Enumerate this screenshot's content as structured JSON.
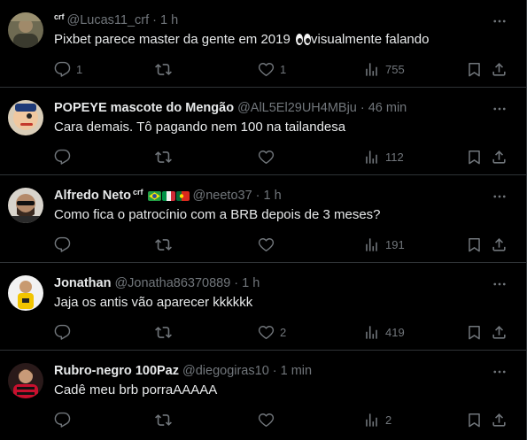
{
  "tweets": [
    {
      "name": "crf",
      "name_style": "small",
      "handle": "@Lucas11_crf",
      "time": "1 h",
      "text": "Pixbet parece master da gente em 2019",
      "text_after_emoji": "visualmente falando",
      "emoji": "eyes-emoji",
      "avatar_color": "#8a7a55",
      "replies": "1",
      "retweets": "",
      "likes": "1",
      "views": "755"
    },
    {
      "name": "POPEYE mascote do Mengão",
      "handle": "@AlL5El29UH4MBju",
      "time": "46 min",
      "text": "Cara demais. Tô pagando nem 100 na tailandesa",
      "avatar_color": "#c43a2c",
      "replies": "",
      "retweets": "",
      "likes": "",
      "views": "112"
    },
    {
      "name": "Alfredo Neto",
      "name_suffix": "crf",
      "flags": [
        "brazil-flag",
        "italy-flag",
        "portugal-flag"
      ],
      "handle": "@neeto37",
      "time": "1 h",
      "text": "Como fica o patrocínio com a BRB depois de 3 meses?",
      "avatar_color": "#6b5a4a",
      "replies": "",
      "retweets": "",
      "likes": "",
      "views": "191"
    },
    {
      "name": "Jonathan",
      "handle": "@Jonatha86370889",
      "time": "1 h",
      "text": "Jaja os antis vão aparecer kkkkkk",
      "avatar_color": "#e9e9e9",
      "replies": "",
      "retweets": "",
      "likes": "2",
      "views": "419"
    },
    {
      "name": "Rubro-negro 100Paz",
      "handle": "@diegogiras10",
      "time": "1 min",
      "text": "Cadê meu brb porraAAAAA",
      "avatar_color": "#b3262b",
      "replies": "",
      "retweets": "",
      "likes": "",
      "views": "2"
    }
  ],
  "separator": "·",
  "colors": {
    "background": "#000000",
    "text": "#e7e9ea",
    "muted": "#71767b",
    "border": "#2f3336"
  }
}
